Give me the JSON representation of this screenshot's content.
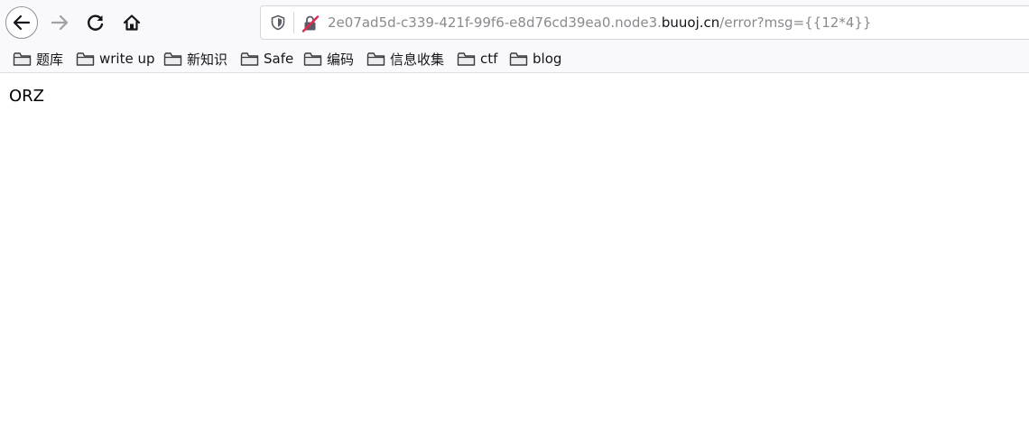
{
  "toolbar": {
    "icons": {
      "back": "back-arrow-icon",
      "forward": "forward-arrow-icon",
      "reload": "reload-icon",
      "home": "home-icon"
    },
    "url": {
      "prefix": "2e07ad5d-c339-421f-99f6-e8d76cd39ea0.node3.",
      "host": "buuoj.cn",
      "path": "/error?msg={{12*4}}",
      "icons": [
        "shield-icon",
        "insecure-connection-icon"
      ]
    }
  },
  "bookmarks": [
    {
      "label": "题库",
      "icon": "folder-icon"
    },
    {
      "label": "write up",
      "icon": "folder-icon"
    },
    {
      "label": "新知识",
      "icon": "folder-icon"
    },
    {
      "label": "Safe",
      "icon": "folder-icon"
    },
    {
      "label": "编码",
      "icon": "folder-icon"
    },
    {
      "label": "信息收集",
      "icon": "folder-icon"
    },
    {
      "label": "ctf",
      "icon": "folder-icon"
    },
    {
      "label": "blog",
      "icon": "folder-icon"
    }
  ],
  "page": {
    "text": "ORZ"
  },
  "colors": {
    "chrome_bg": "#f9f9fb",
    "url_dim": "#8a8a8f",
    "url_host": "#15141a",
    "insecure_accent": "#e22850"
  }
}
